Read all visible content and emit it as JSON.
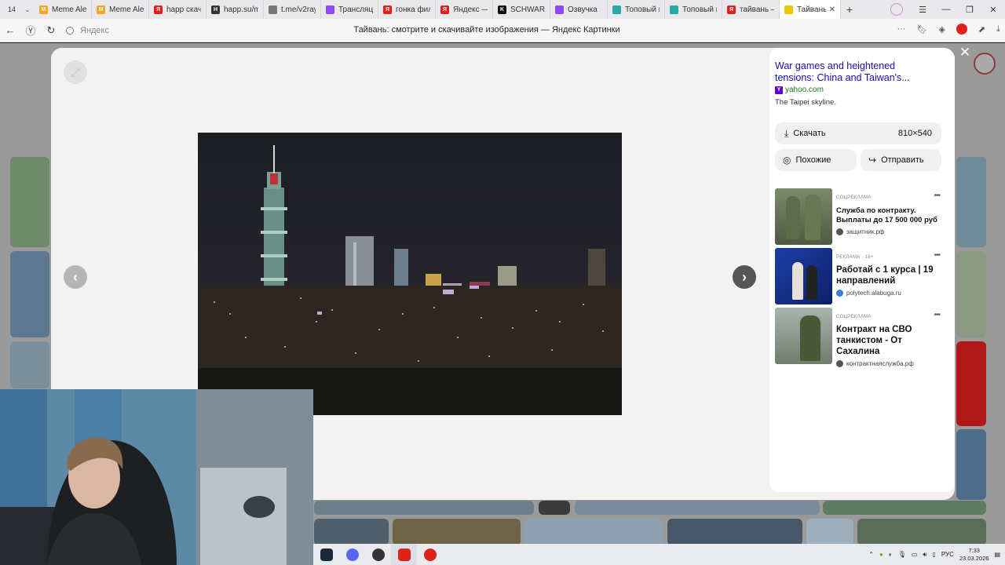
{
  "browser": {
    "tab_count": "14",
    "tabs": [
      {
        "label": "Meme Alert",
        "fav_color": "#f5a623",
        "fav_glyph": "M"
      },
      {
        "label": "Meme Alert",
        "fav_color": "#f5a623",
        "fav_glyph": "M"
      },
      {
        "label": "happ скача",
        "fav_color": "#e0201b",
        "fav_glyph": "Я"
      },
      {
        "label": "happ.su/m",
        "fav_color": "#333333",
        "fav_glyph": "H"
      },
      {
        "label": "t.me/v2ray",
        "fav_color": "#777777",
        "fav_glyph": ""
      },
      {
        "label": "Трансляци",
        "fav_color": "#9146ff",
        "fav_glyph": ""
      },
      {
        "label": "гонка фил",
        "fav_color": "#e0201b",
        "fav_glyph": "Я"
      },
      {
        "label": "Яндекс —",
        "fav_color": "#e0201b",
        "fav_glyph": "Я"
      },
      {
        "label": "SCHWART",
        "fav_color": "#111111",
        "fav_glyph": "K"
      },
      {
        "label": "Озвучка",
        "fav_color": "#9146ff",
        "fav_glyph": ""
      },
      {
        "label": "Топовый к",
        "fav_color": "#2aa8a8",
        "fav_glyph": ""
      },
      {
        "label": "Топовый к",
        "fav_color": "#2aa8a8",
        "fav_glyph": ""
      },
      {
        "label": "тайвань –",
        "fav_color": "#e0201b",
        "fav_glyph": "Я"
      }
    ],
    "active_tab": {
      "label": "Тайвань",
      "fav_color": "#f5c400"
    },
    "address_placeholder": "Яндекс",
    "page_title": "Тайвань: смотрите и скачивайте изображения — Яндекс Картинки"
  },
  "viewer": {
    "source": {
      "title": "War games and heightened tensions: China and Taiwan's...",
      "site": "yahoo.com",
      "description": "The Taipei skyline."
    },
    "download_label": "Скачать",
    "image_size": "810×540",
    "similar_label": "Похожие",
    "send_label": "Отправить",
    "ads": [
      {
        "kind": "СОЦРЕКЛАМА",
        "title": "Служба по контракту. Выплаты до 17 500 000 руб",
        "domain": "защитник.рф"
      },
      {
        "kind": "РЕКЛАМА · 16+",
        "title": "Работай с 1 курса | 19 направлений",
        "domain": "polytech.alabuga.ru"
      },
      {
        "kind": "СОЦРЕКЛАМА",
        "title": "Контракт на СВО танкистом - От Сахалина",
        "domain": "контрактнаяслужба.рф"
      }
    ]
  },
  "taskbar": {
    "lang": "РУС",
    "time": "7:33",
    "date": "23.03.2026"
  }
}
